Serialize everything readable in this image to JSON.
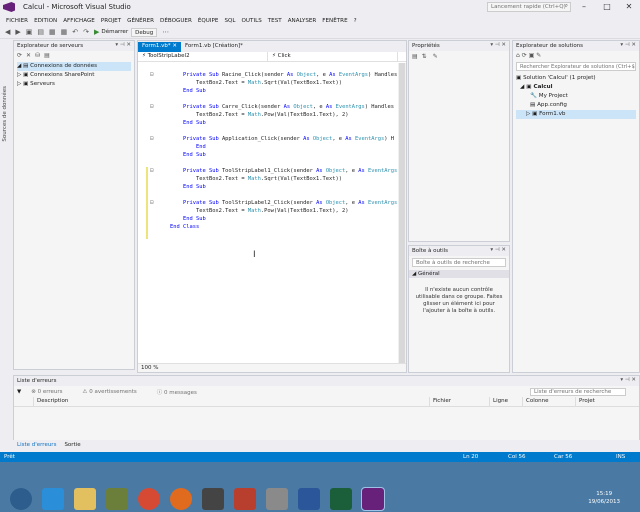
{
  "window": {
    "title": "Calcul - Microsoft Visual Studio",
    "quick_launch": "Lancement rapide (Ctrl+Q)"
  },
  "menu": [
    "FICHIER",
    "EDITION",
    "AFFICHAGE",
    "PROJET",
    "GÉNÉRER",
    "DÉBOGUER",
    "ÉQUIPE",
    "SQL",
    "OUTILS",
    "TEST",
    "ANALYSER",
    "FENÊTRE",
    "?"
  ],
  "toolbar": {
    "start": "Démarrer",
    "config": "Debug"
  },
  "side_tab": "Sources de données",
  "server_explorer": {
    "title": "Explorateur de serveurs",
    "items": [
      "Connexions de données",
      "Connexions SharePoint",
      "Serveurs"
    ]
  },
  "editor": {
    "tabs": [
      "Form1.vb*",
      "Form1.vb [Création]*"
    ],
    "nav_left": "ToolStripLabel2",
    "nav_right": "Click",
    "zoom": "100 %",
    "code": [
      [
        "    ",
        "Private Sub ",
        "Racine_Click(sender ",
        "As ",
        "Object",
        ", e ",
        "As ",
        "EventArgs",
        ") Handles"
      ],
      [
        "        TextBox2.Text = ",
        "",
        "",
        "",
        "Math",
        ".Sqrt(Val(TextBox1.Text))",
        "",
        "",
        ""
      ],
      [
        "    ",
        "End Sub",
        "",
        "",
        "",
        "",
        "",
        "",
        ""
      ],
      [
        "",
        "",
        "",
        "",
        "",
        "",
        "",
        "",
        ""
      ],
      [
        "    ",
        "Private Sub ",
        "Carre_Click(sender ",
        "As ",
        "Object",
        ", e ",
        "As ",
        "EventArgs",
        ") Handles"
      ],
      [
        "        TextBox2.Text = ",
        "",
        "",
        "",
        "Math",
        ".Pow(Val(TextBox1.Text), 2)",
        "",
        "",
        ""
      ],
      [
        "    ",
        "End Sub",
        "",
        "",
        "",
        "",
        "",
        "",
        ""
      ],
      [
        "",
        "",
        "",
        "",
        "",
        "",
        "",
        "",
        ""
      ],
      [
        "    ",
        "Private Sub ",
        "Application_Click(sender ",
        "As ",
        "Object",
        ", e ",
        "As ",
        "EventArgs",
        ") H"
      ],
      [
        "        ",
        "End",
        "",
        "",
        "",
        "",
        "",
        "",
        ""
      ],
      [
        "    ",
        "End Sub",
        "",
        "",
        "",
        "",
        "",
        "",
        ""
      ],
      [
        "",
        "",
        "",
        "",
        "",
        "",
        "",
        "",
        ""
      ],
      [
        "    ",
        "Private Sub ",
        "ToolStripLabel1_Click(sender ",
        "As ",
        "Object",
        ", e ",
        "As ",
        "EventArgs",
        ""
      ],
      [
        "        TextBox2.Text = ",
        "",
        "",
        "",
        "Math",
        ".Sqrt(Val(TextBox1.Text))",
        "",
        "",
        ""
      ],
      [
        "    ",
        "End Sub",
        "",
        "",
        "",
        "",
        "",
        "",
        ""
      ],
      [
        "",
        "",
        "",
        "",
        "",
        "",
        "",
        "",
        ""
      ],
      [
        "    ",
        "Private Sub ",
        "ToolStripLabel2_Click(sender ",
        "As ",
        "Object",
        ", e ",
        "As ",
        "EventArgs",
        ""
      ],
      [
        "        TextBox2.Text = ",
        "",
        "",
        "",
        "Math",
        ".Pow(Val(TextBox1.Text), 2)",
        "",
        "",
        ""
      ],
      [
        "    ",
        "End Sub",
        "",
        "",
        "",
        "",
        "",
        "",
        ""
      ],
      [
        "",
        "End Class",
        "",
        "",
        "",
        "",
        "",
        "",
        ""
      ]
    ]
  },
  "properties": {
    "title": "Propriétés"
  },
  "toolbox": {
    "title": "Boîte à outils",
    "search": "Boîte à outils de recherche",
    "group": "Général",
    "message": "Il n'existe aucun contrôle utilisable dans ce groupe. Faites glisser un élément ici pour l'ajouter à la boîte à outils."
  },
  "solution": {
    "title": "Explorateur de solutions",
    "search": "Rechercher Explorateur de solutions (Ctrl+$)",
    "items": [
      "Solution 'Calcul' (1 projet)",
      "Calcul",
      "My Project",
      "App.config",
      "Form1.vb"
    ]
  },
  "errors": {
    "title": "Liste d'erreurs",
    "errors": "0 erreurs",
    "warnings": "0 avertissements",
    "messages": "0 messages",
    "search": "Liste d'erreurs de recherche",
    "columns": [
      "Description",
      "Fichier",
      "Ligne",
      "Colonne",
      "Projet"
    ],
    "tabs": [
      "Liste d'erreurs",
      "Sortie"
    ]
  },
  "status": {
    "ready": "Prêt",
    "ln": "Ln 20",
    "col": "Col 56",
    "car": "Car 56",
    "ins": "INS"
  },
  "clock": {
    "time": "15:19",
    "date": "19/06/2013"
  }
}
